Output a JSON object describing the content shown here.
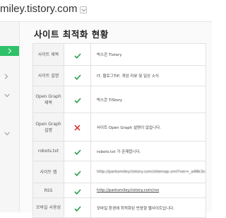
{
  "header": {
    "site_title": "miley.tistory.com"
  },
  "main": {
    "title": "사이트 최적화 현황"
  },
  "colors": {
    "ok": "#2b9e4a",
    "error": "#d9242b",
    "sidebar_active": "#2ec16a"
  },
  "rows": [
    {
      "label": "사이트 제목",
      "status": "ok",
      "value": "박스콘 Tistory"
    },
    {
      "label": "사이트 설명",
      "status": "ok",
      "value": "IT, 블로그TIP, 게임 리뷰 및 일상 소식"
    },
    {
      "label": "Open Graph 제목",
      "status": "ok",
      "value": "박스콘 TiStory"
    },
    {
      "label": "Open Graph 설명",
      "status": "error",
      "value": "사이트 Open Graph 설명이 없습니다."
    },
    {
      "label": "robots.txt",
      "status": "ok",
      "value": "robots.txt 가 존재합니다."
    },
    {
      "label": "사이트 맵",
      "status": "ok",
      "value": "http://parksmiley.tistory.com/sitemap.xml?ver=_a48k3s93bf0e8d2f"
    },
    {
      "label": "RSS",
      "status": "ok",
      "value": "http://parksmiley.tistory.com/rss"
    },
    {
      "label": "모바일 사용성",
      "status": "ok",
      "value": "모바일 환경에 최적화된 반응형 웹사이트입니다."
    }
  ]
}
